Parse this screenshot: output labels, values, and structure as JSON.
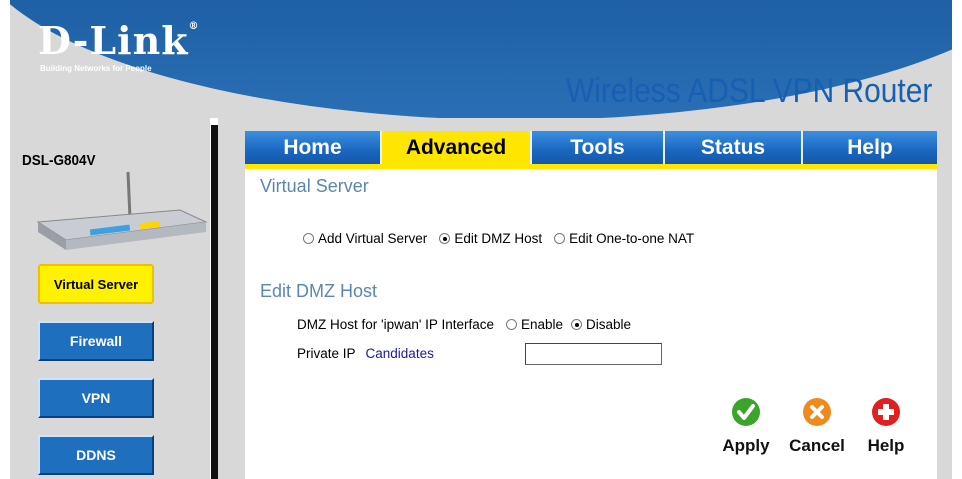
{
  "header": {
    "brand": "D-Link",
    "brand_mark": "®",
    "tagline": "Building Networks for People",
    "product": "Wireless ADSL VPN Router"
  },
  "sidebar": {
    "model": "DSL-G804V",
    "items": [
      {
        "label": "Virtual Server",
        "active": true
      },
      {
        "label": "Firewall",
        "active": false
      },
      {
        "label": "VPN",
        "active": false
      },
      {
        "label": "DDNS",
        "active": false
      }
    ]
  },
  "tabs": [
    {
      "label": "Home",
      "active": false
    },
    {
      "label": "Advanced",
      "active": true
    },
    {
      "label": "Tools",
      "active": false
    },
    {
      "label": "Status",
      "active": false
    },
    {
      "label": "Help",
      "active": false
    }
  ],
  "main": {
    "section_title": "Virtual Server",
    "options": [
      {
        "label": "Add Virtual Server",
        "selected": false
      },
      {
        "label": "Edit DMZ Host",
        "selected": true
      },
      {
        "label": "Edit One-to-one NAT",
        "selected": false
      }
    ],
    "subsection_title": "Edit DMZ Host",
    "dmz_label": "DMZ Host for 'ipwan' IP Interface",
    "enable_label": "Enable",
    "disable_label": "Disable",
    "dmz_enabled": false,
    "private_ip_label": "Private IP",
    "candidates_link": "Candidates",
    "private_ip_value": ""
  },
  "actions": {
    "apply": "Apply",
    "cancel": "Cancel",
    "help": "Help"
  },
  "colors": {
    "accent_yellow": "#ffe600",
    "tab_blue": "#1a66bf",
    "apply_green": "#3aa52a",
    "cancel_orange": "#f08a1c",
    "help_red": "#e02020"
  }
}
